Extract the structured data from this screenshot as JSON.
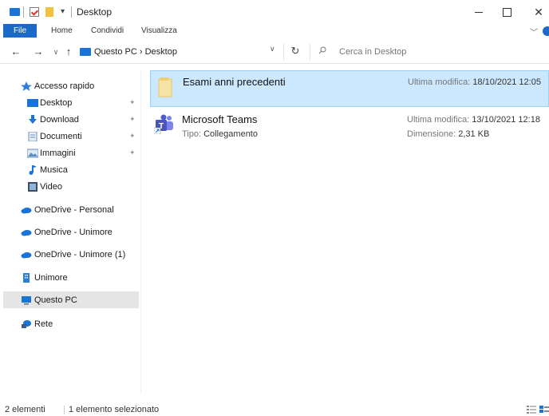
{
  "window": {
    "title": "Desktop",
    "controls": {
      "minimize": "minimize",
      "maximize": "maximize",
      "close": "✕"
    }
  },
  "ribbon": {
    "tabs": [
      {
        "label": "File"
      },
      {
        "label": "Home"
      },
      {
        "label": "Condividi"
      },
      {
        "label": "Visualizza"
      }
    ]
  },
  "address": {
    "path": "Questo PC  ›  Desktop",
    "search_placeholder": "Cerca in Desktop"
  },
  "sidebar": {
    "items": [
      {
        "label": "Accesso rapido",
        "icon": "star-icon"
      },
      {
        "label": "Desktop",
        "icon": "desktop-folder-icon",
        "pinned": true
      },
      {
        "label": "Download",
        "icon": "download-icon",
        "pinned": true
      },
      {
        "label": "Documenti",
        "icon": "documents-icon",
        "pinned": true
      },
      {
        "label": "Immagini",
        "icon": "pictures-icon",
        "pinned": true
      },
      {
        "label": "Musica",
        "icon": "music-icon"
      },
      {
        "label": "Video",
        "icon": "video-icon"
      },
      {
        "label": "OneDrive - Personal",
        "icon": "onedrive-icon"
      },
      {
        "label": "OneDrive - Unimore",
        "icon": "onedrive-icon"
      },
      {
        "label": "OneDrive - Unimore (1)",
        "icon": "onedrive-icon"
      },
      {
        "label": "Unimore",
        "icon": "building-icon"
      },
      {
        "label": "Questo PC",
        "icon": "pc-icon",
        "selected": true
      },
      {
        "label": "Rete",
        "icon": "network-icon"
      }
    ]
  },
  "files": [
    {
      "name": "Esami anni precedenti",
      "icon": "folder-icon",
      "modified_label": "Ultima modifica:",
      "modified_value": "18/10/2021 12:05",
      "selected": true
    },
    {
      "name": "Microsoft Teams",
      "icon": "teams-icon",
      "type_label": "Tipo:",
      "type_value": "Collegamento",
      "modified_label": "Ultima modifica:",
      "modified_value": "13/10/2021 12:18",
      "size_label": "Dimensione:",
      "size_value": "2,31 KB"
    }
  ],
  "status": {
    "count": "2 elementi",
    "selection": "1 elemento selezionato"
  },
  "colors": {
    "accent": "#1b6ac9",
    "selection": "#cce8ff",
    "selection_border": "#99d1ff",
    "onedrive": "#1a73d6"
  }
}
